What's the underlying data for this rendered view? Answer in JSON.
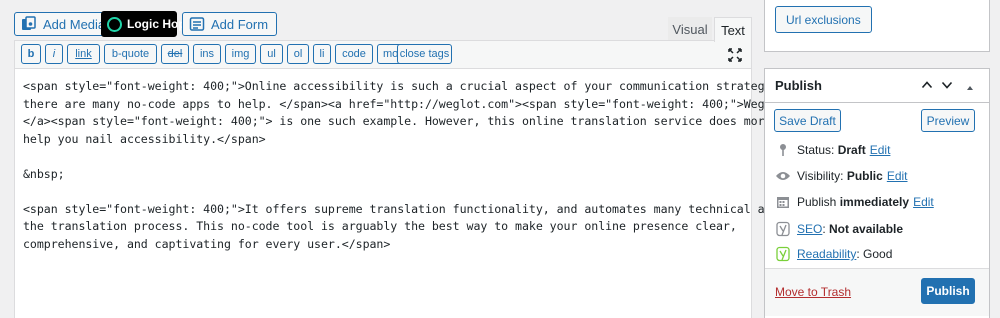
{
  "media_buttons": {
    "add_media": "Add Media",
    "logic_hop": "Logic Hop",
    "add_form": "Add Form"
  },
  "editor_tabs": {
    "visual": "Visual",
    "text": "Text",
    "active": "text"
  },
  "quicktags": [
    "b",
    "i",
    "link",
    "b-quote",
    "del",
    "ins",
    "img",
    "ul",
    "ol",
    "li",
    "code",
    "more",
    "close tags"
  ],
  "editor": {
    "lines": [
      "<span style=\"font-weight: 400;\">Online accessibility is such a crucial aspect of your communication strategy that",
      "there are many no-code apps to help. </span><a href=\"http://weglot.com\"><span style=\"font-weight: 400;\">Weglot</span>",
      "</a><span style=\"font-weight: 400;\"> is one such example. However, this online translation service does more than",
      "help you nail accessibility.</span>",
      "",
      "&nbsp;",
      "",
      "<span style=\"font-weight: 400;\">It offers supreme translation functionality, and automates many technical aspects of",
      "the translation process. This no-code tool is arguably the best way to make your online presence clear,",
      "comprehensive, and captivating for every user.</span>"
    ]
  },
  "url_box": {
    "button": "Url exclusions"
  },
  "publish_box": {
    "title": "Publish",
    "save_draft": "Save Draft",
    "preview": "Preview",
    "status_label": "Status:",
    "status_value": "Draft",
    "visibility_label": "Visibility:",
    "visibility_value": "Public",
    "publish_label": "Publish",
    "publish_value": "immediately",
    "edit": "Edit",
    "seo_label": "SEO",
    "seo_value": "Not available",
    "readability_label": "Readability",
    "readability_value": "Good",
    "move_to_trash": "Move to Trash",
    "publish_button": "Publish"
  },
  "colors": {
    "accent": "#2271b1",
    "trash": "#b32d2e",
    "logic_hop_ring": "#1fd3a8"
  },
  "icons": [
    "add-media-icon",
    "logic-hop-logo",
    "add-form-icon",
    "fullscreen-icon",
    "chevron-up-icon",
    "chevron-down-icon",
    "triangle-up-icon",
    "pin-icon",
    "eye-icon",
    "calendar-icon",
    "yoast-seo-icon",
    "yoast-readability-icon"
  ]
}
